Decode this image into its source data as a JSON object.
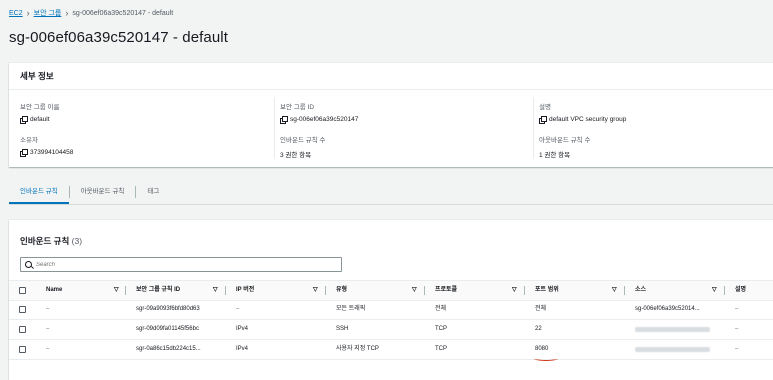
{
  "breadcrumb": {
    "root": "EC2",
    "section": "보안 그룹",
    "current": "sg-006ef06a39c520147 - default"
  },
  "page_title": "sg-006ef06a39c520147 - default",
  "details": {
    "header": "세부 정보",
    "group_name": {
      "label": "보안 그룹 이름",
      "value": "default"
    },
    "group_id": {
      "label": "보안 그룹 ID",
      "value": "sg-006ef06a39c520147"
    },
    "description": {
      "label": "설명",
      "value": "default VPC security group"
    },
    "owner": {
      "label": "소유자",
      "value": "373994104458"
    },
    "inbound_count": {
      "label": "인바운드 규칙 수",
      "value": "3 권한 항목"
    },
    "outbound_count": {
      "label": "아웃바운드 규칙 수",
      "value": "1 권한 항목"
    }
  },
  "tabs": {
    "inbound": "인바운드 규칙",
    "outbound": "아웃바운드 규칙",
    "tags": "태그"
  },
  "rules": {
    "title": "인바운드 규칙",
    "count": "(3)",
    "search_placeholder": "Search",
    "columns": [
      "Name",
      "보안 그룹 규칙 ID",
      "IP 버전",
      "유형",
      "프로토콜",
      "포트 범위",
      "소스",
      "설명"
    ],
    "rows": [
      {
        "name": "–",
        "rule_id": "sgr-09a9093f6bfd80d63",
        "ip": "–",
        "type": "모든 트래픽",
        "protocol": "전체",
        "port": "전체",
        "source": "sg-006ef06a39c52014...",
        "desc": "–"
      },
      {
        "name": "–",
        "rule_id": "sgr-09d09fa01145f56bc",
        "ip": "IPv4",
        "type": "SSH",
        "protocol": "TCP",
        "port": "22",
        "source": "",
        "desc": "–"
      },
      {
        "name": "–",
        "rule_id": "sgr-0a86c15db224c15...",
        "ip": "IPv4",
        "type": "사용자 지정 TCP",
        "protocol": "TCP",
        "port": "8080",
        "source": "",
        "desc": "–"
      }
    ]
  },
  "colors": {
    "link": "#0073bb",
    "accent_underline": "#d13212"
  }
}
